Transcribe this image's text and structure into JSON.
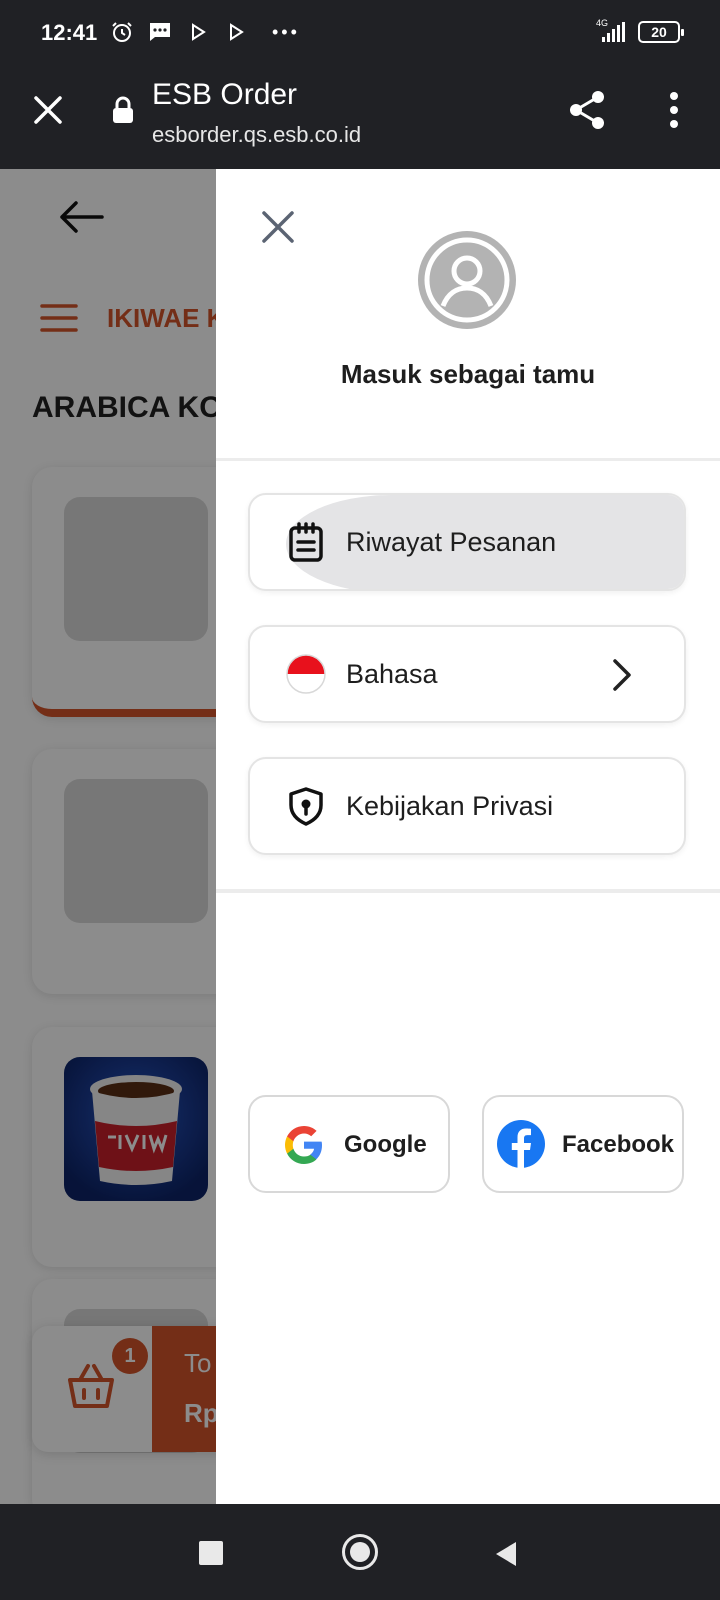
{
  "status_bar": {
    "time": "12:41",
    "network": "4G",
    "battery": "20",
    "icons": [
      "alarm-icon",
      "message-icon",
      "play-icon",
      "play-icon",
      "more-dots-icon",
      "signal-icon",
      "battery-icon"
    ]
  },
  "browser": {
    "title": "ESB Order",
    "url": "esborder.qs.esb.co.id"
  },
  "page": {
    "brand": "IKIWAE K",
    "section_title": "ARABICA KO",
    "cart": {
      "badge_count": "1",
      "total_label": "To",
      "total_value": "Rp"
    }
  },
  "drawer": {
    "guest_label": "Masuk sebagai tamu",
    "menu": [
      {
        "label": "Riwayat Pesanan",
        "icon": "order-history-icon"
      },
      {
        "label": "Bahasa",
        "icon": "indonesia-flag-icon"
      },
      {
        "label": "Kebijakan Privasi",
        "icon": "privacy-shield-icon"
      }
    ],
    "social": [
      {
        "label": "Google",
        "icon": "google-icon"
      },
      {
        "label": "Facebook",
        "icon": "facebook-icon"
      }
    ]
  },
  "colors": {
    "accent": "#d4542a",
    "bar_background": "#202125",
    "facebook_blue": "#1877f2"
  }
}
